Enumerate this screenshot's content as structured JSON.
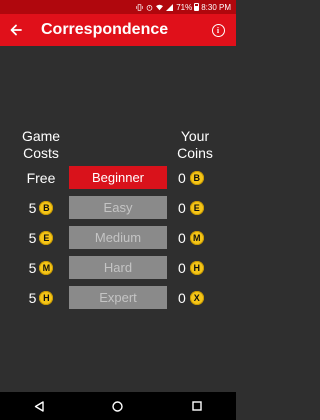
{
  "status_bar": {
    "battery": "71%",
    "time": "8:30 PM"
  },
  "app_bar": {
    "title": "Correspondence",
    "back_icon": "back-arrow-icon",
    "info_icon": "info-icon"
  },
  "table": {
    "header_costs": "Game\nCosts",
    "header_coins": "Your\nCoins",
    "rows": [
      {
        "cost_value": "Free",
        "cost_coin": "",
        "level": "Beginner",
        "state": "active",
        "coins_value": "0",
        "coin_letter": "B"
      },
      {
        "cost_value": "5",
        "cost_coin": "B",
        "level": "Easy",
        "state": "locked",
        "coins_value": "0",
        "coin_letter": "E"
      },
      {
        "cost_value": "5",
        "cost_coin": "E",
        "level": "Medium",
        "state": "locked",
        "coins_value": "0",
        "coin_letter": "M"
      },
      {
        "cost_value": "5",
        "cost_coin": "M",
        "level": "Hard",
        "state": "locked",
        "coins_value": "0",
        "coin_letter": "H"
      },
      {
        "cost_value": "5",
        "cost_coin": "H",
        "level": "Expert",
        "state": "locked",
        "coins_value": "0",
        "coin_letter": "X"
      }
    ]
  },
  "colors": {
    "app_bar": "#e0101a",
    "status_bar": "#b0070d",
    "background": "#2f2f2f",
    "active_button": "#d9121b",
    "locked_button": "#8a8a8a",
    "coin": "#f5c518"
  },
  "nav_bar": {
    "back_icon": "nav-back-icon",
    "home_icon": "nav-home-icon",
    "recents_icon": "nav-recents-icon"
  }
}
